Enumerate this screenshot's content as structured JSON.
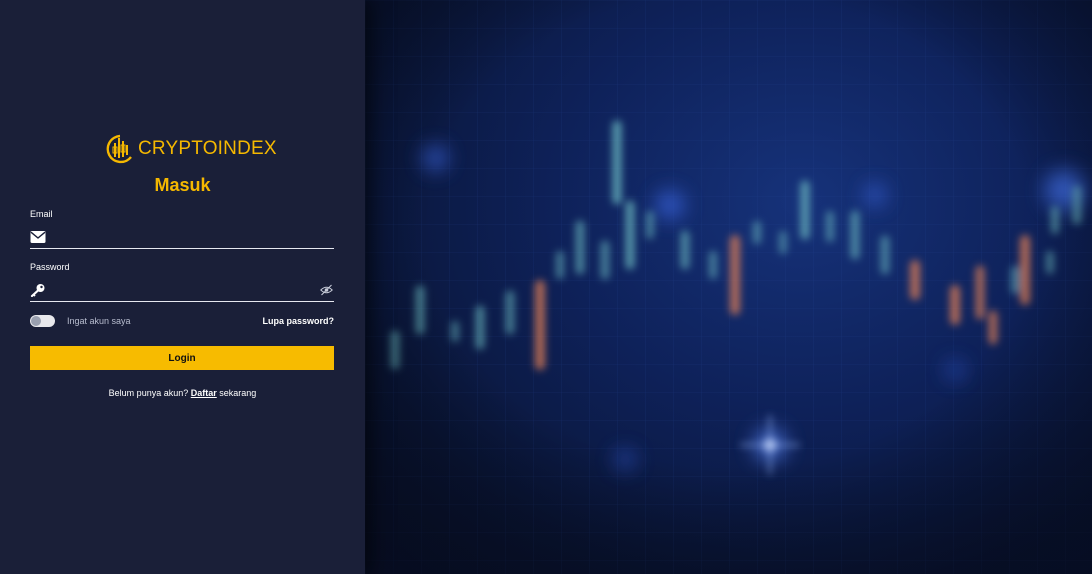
{
  "brand": {
    "name": "CRYPTOINDEX",
    "color": "#f5b800"
  },
  "login": {
    "heading": "Masuk",
    "email": {
      "label": "Email",
      "value": "",
      "icon": "envelope-icon"
    },
    "password": {
      "label": "Password",
      "value": "",
      "icon": "key-icon",
      "toggle_icon": "eye-slash-icon"
    },
    "remember": {
      "label": "Ingat akun saya",
      "checked": false
    },
    "forgot_label": "Lupa password?",
    "submit_label": "Login",
    "signup": {
      "prefix": "Belum punya akun?",
      "link": "Daftar",
      "suffix": "sekarang"
    }
  },
  "colors": {
    "panel_bg": "#1a1f38",
    "accent": "#f7bb00",
    "background": "#0e2159"
  }
}
